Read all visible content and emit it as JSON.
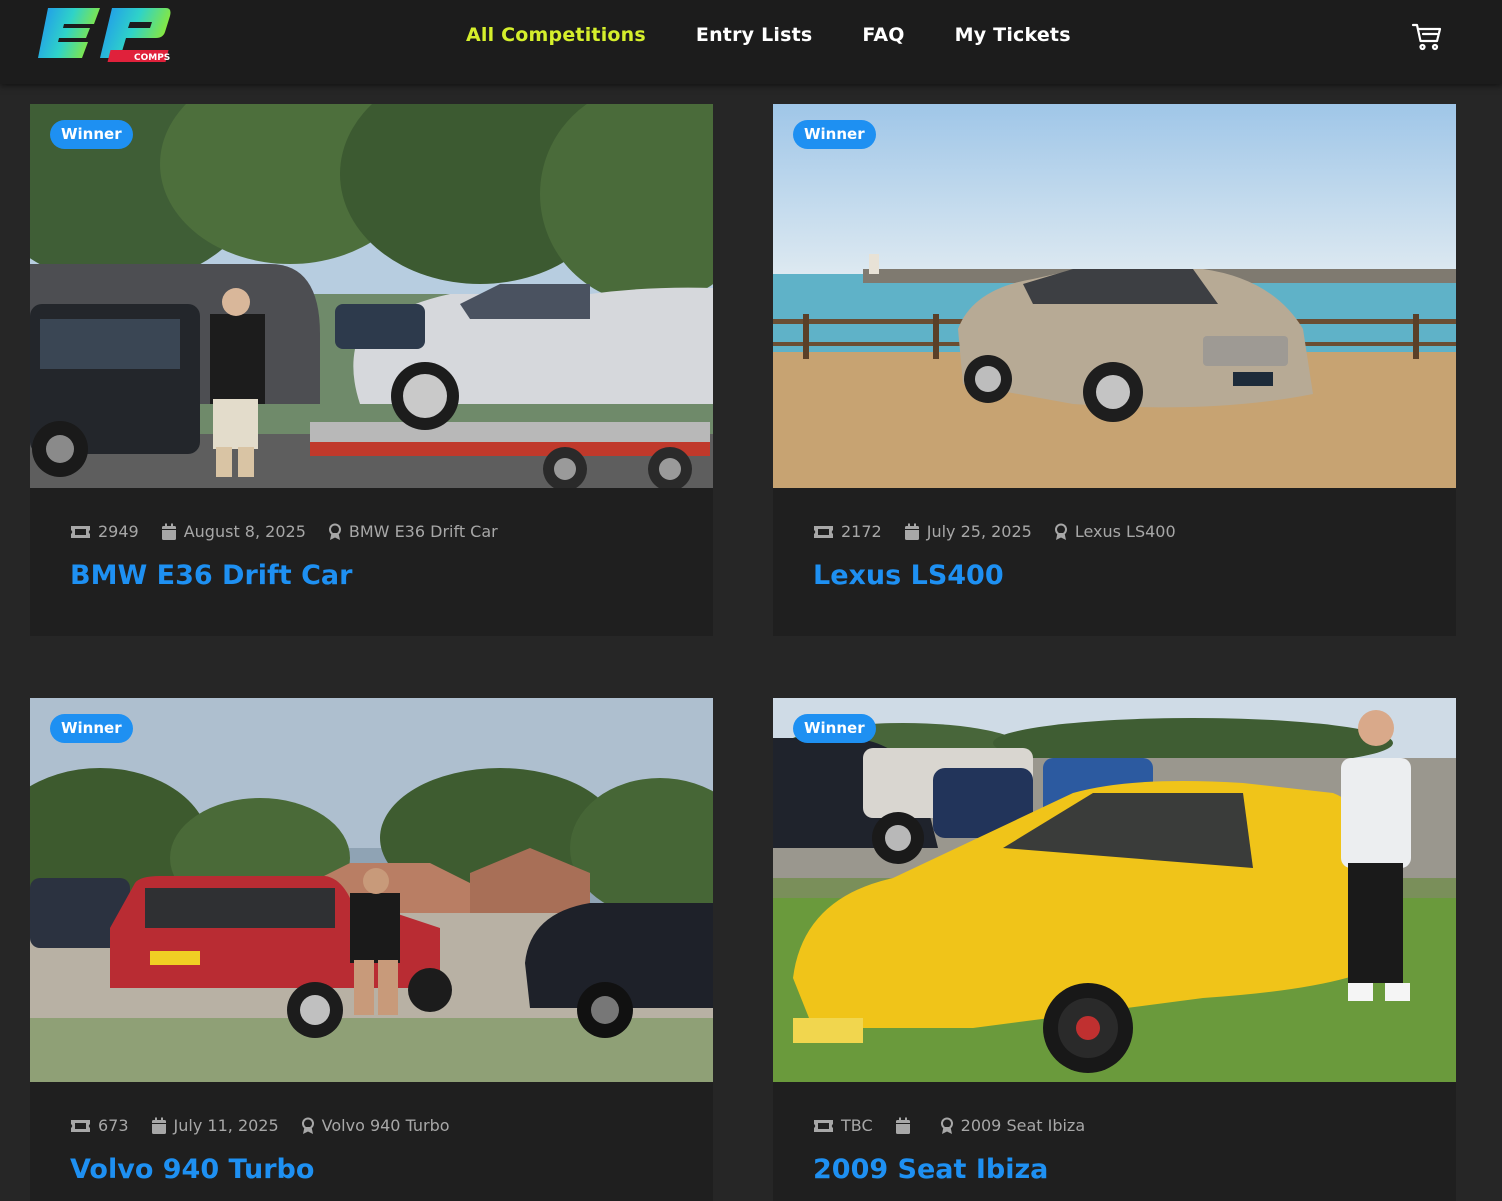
{
  "brand": {
    "logo_text": "ep",
    "logo_sub": "COMPS"
  },
  "nav": {
    "items": [
      {
        "label": "All Competitions",
        "active": true
      },
      {
        "label": "Entry Lists",
        "active": false
      },
      {
        "label": "FAQ",
        "active": false
      },
      {
        "label": "My Tickets",
        "active": false
      }
    ]
  },
  "icons": {
    "cart": "cart-icon",
    "ticket": "ticket-icon",
    "calendar": "calendar-icon",
    "award": "award-icon"
  },
  "colors": {
    "accent": "#1e90f2",
    "nav_active": "#d5ef2c",
    "header_bg": "#1c1c1c",
    "page_bg": "#262626",
    "card_bg": "#1f1f1f",
    "meta_text": "#a7a7a7"
  },
  "cards": [
    {
      "badge": "Winner",
      "ticket": "2949",
      "date": "August 8, 2025",
      "prize": "BMW E36 Drift Car",
      "title": "BMW E36 Drift Car",
      "scene": "bmw-trailer"
    },
    {
      "badge": "Winner",
      "ticket": "2172",
      "date": "July 25, 2025",
      "prize": "Lexus LS400",
      "title": "Lexus LS400",
      "scene": "lexus-seafront"
    },
    {
      "badge": "Winner",
      "ticket": "673",
      "date": "July 11, 2025",
      "prize": "Volvo 940 Turbo",
      "title": "Volvo 940 Turbo",
      "scene": "volvo-street"
    },
    {
      "badge": "Winner",
      "ticket": "TBC",
      "date": "",
      "prize": "2009 Seat Ibiza",
      "title": "2009 Seat Ibiza",
      "scene": "seat-field"
    }
  ]
}
